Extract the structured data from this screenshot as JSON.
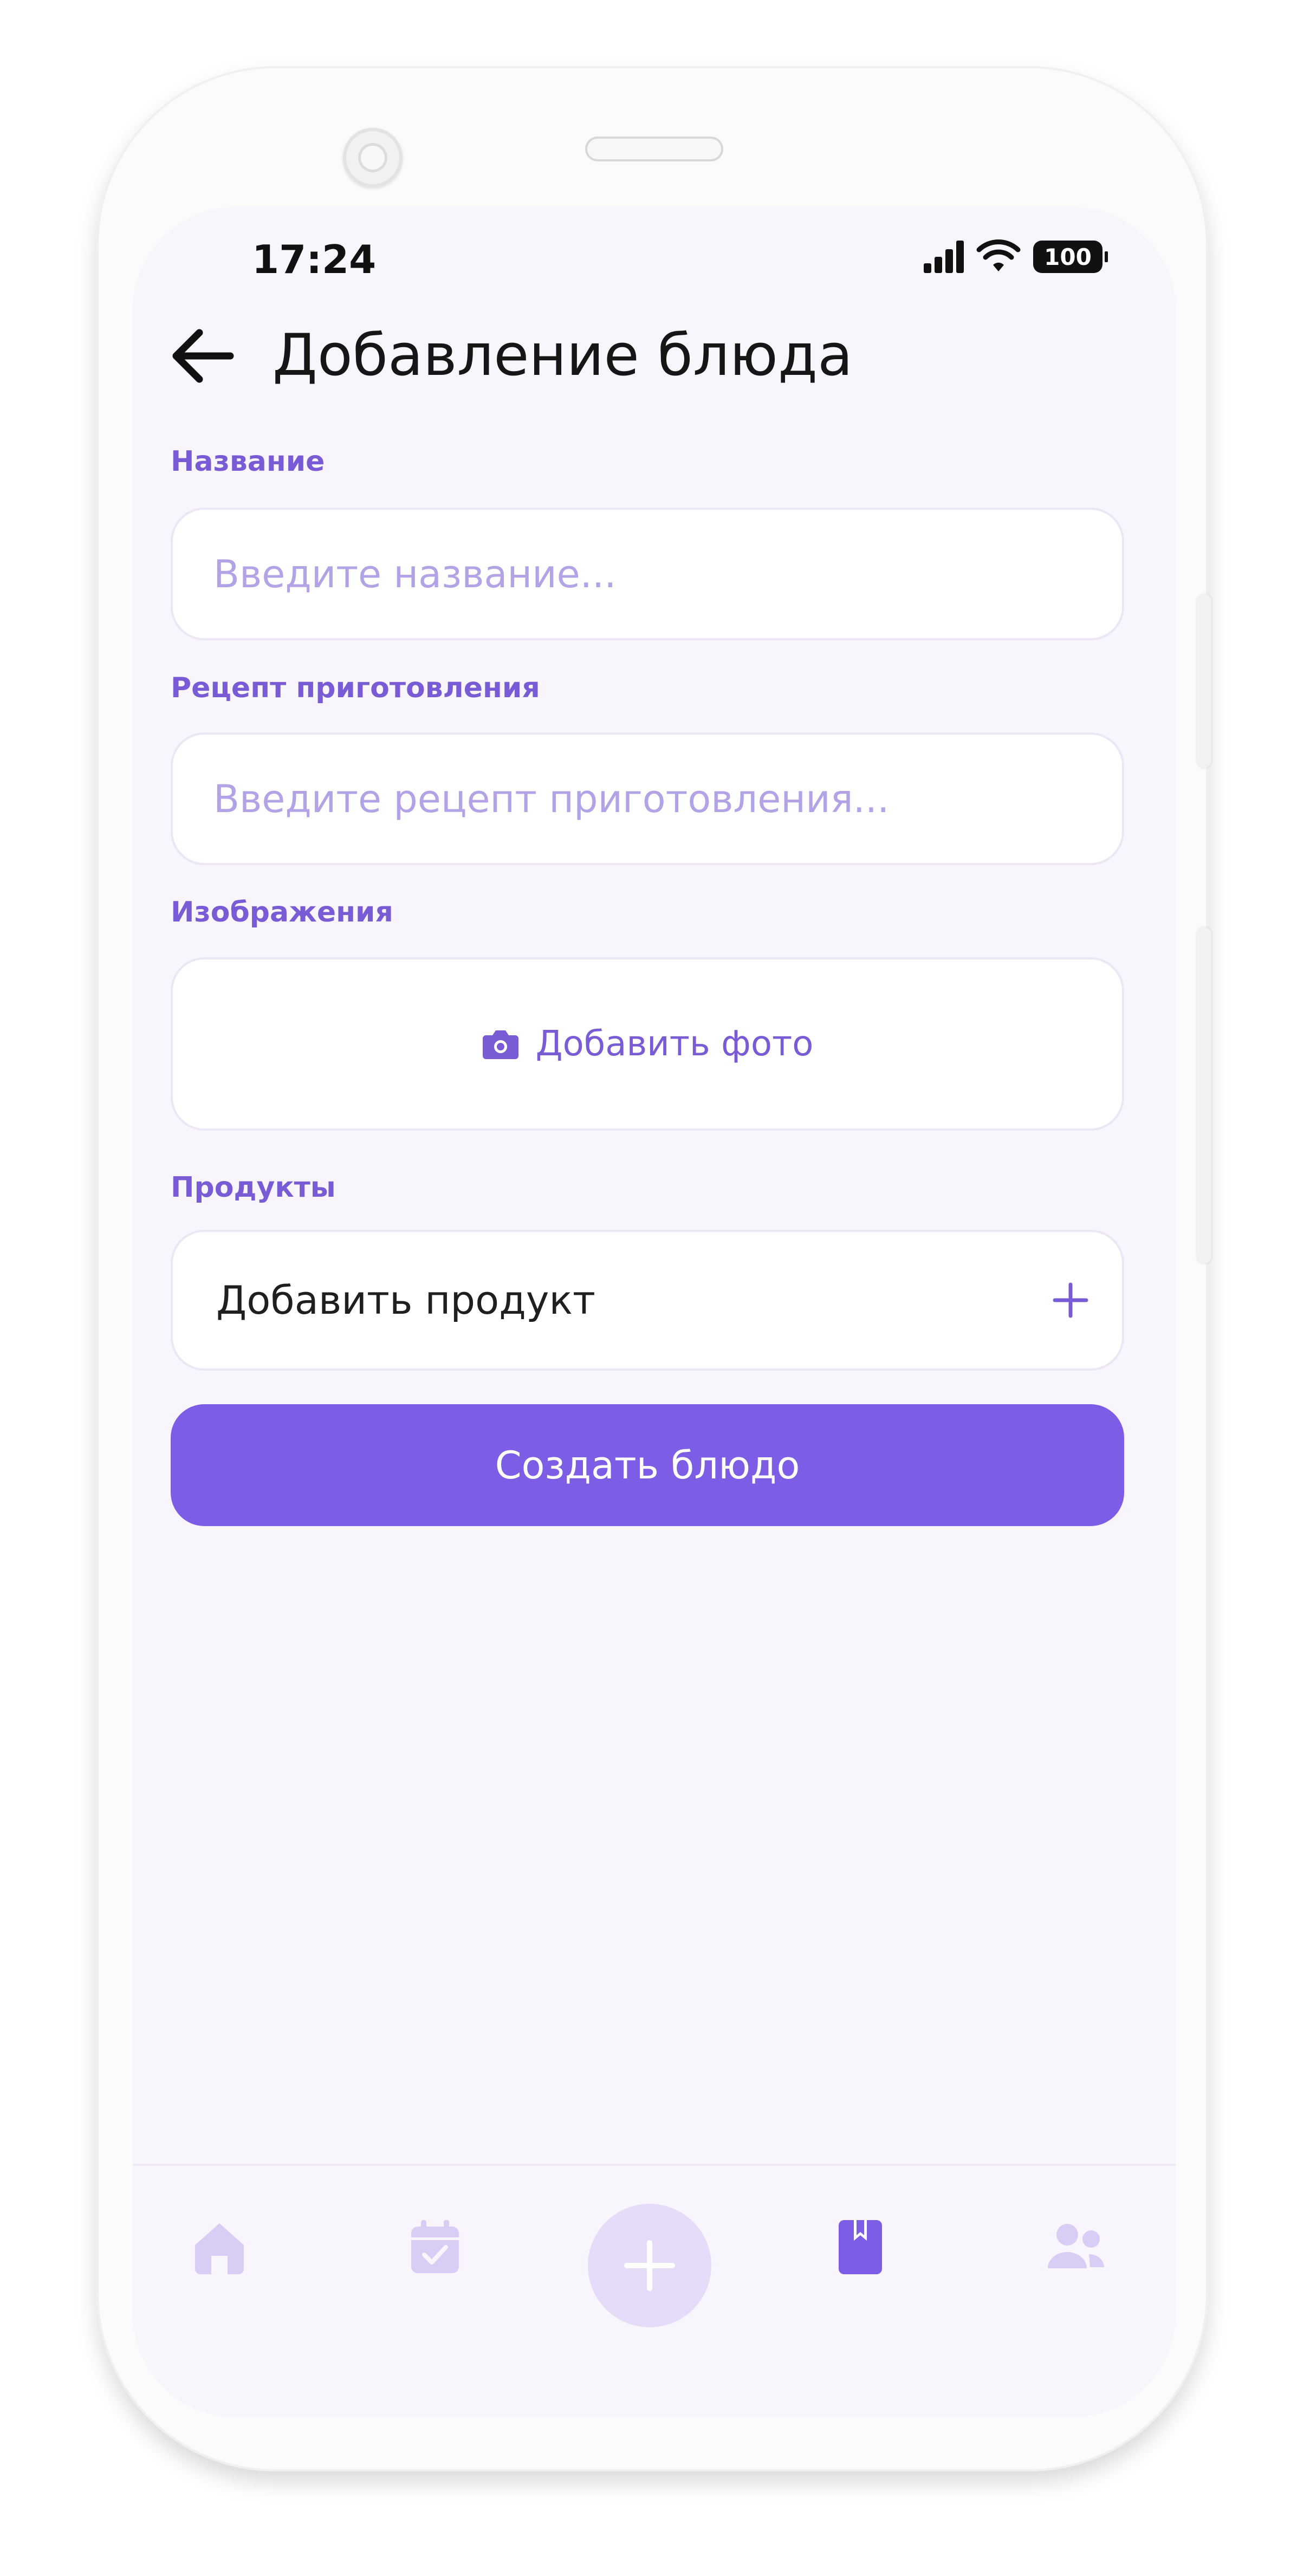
{
  "status_bar": {
    "time": "17:24",
    "battery": "100"
  },
  "header": {
    "title": "Добавление блюда",
    "back_icon": "arrow-left-icon"
  },
  "form": {
    "name": {
      "label": "Название",
      "placeholder": "Введите название..."
    },
    "recipe": {
      "label": "Рецепт приготовления",
      "placeholder": "Введите рецепт приготовления..."
    },
    "images": {
      "label": "Изображения",
      "add_photo": "Добавить фото",
      "icon": "camera-icon"
    },
    "products": {
      "label": "Продукты",
      "add_product": "Добавить продукт",
      "icon": "plus-icon"
    },
    "submit_label": "Создать блюдо"
  },
  "tab_bar": {
    "items": [
      {
        "name": "home",
        "icon": "home-icon",
        "active": false
      },
      {
        "name": "calendar",
        "icon": "calendar-check-icon",
        "active": false
      },
      {
        "name": "add",
        "icon": "plus-icon",
        "active": false
      },
      {
        "name": "recipes",
        "icon": "bookmark-book-icon",
        "active": true
      },
      {
        "name": "users",
        "icon": "users-icon",
        "active": false
      }
    ]
  },
  "colors": {
    "accent": "#7d5de6",
    "label": "#7a5bd6",
    "placeholder": "#b3a3e6",
    "background": "#f8f5fc",
    "inactive_icon": "#d9cdf6",
    "fab_bg": "#e5dcfa"
  }
}
